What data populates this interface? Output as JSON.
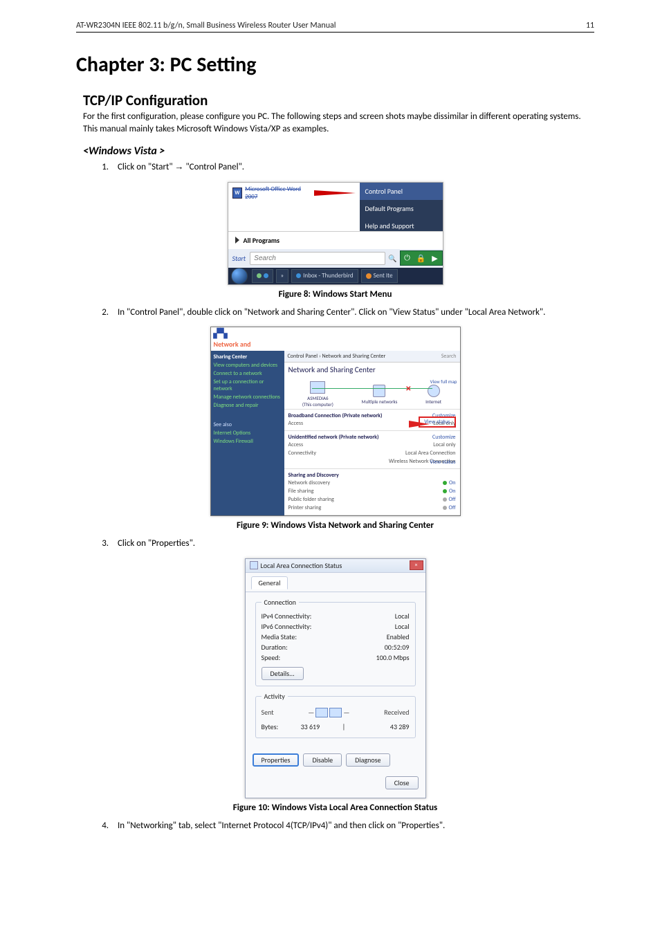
{
  "header": {
    "left": "AT-WR2304N IEEE 802.11 b/g/n, Small Business Wireless Router User Manual",
    "right": "11"
  },
  "h1": "Chapter 3: PC Setting",
  "h2": "TCP/IP Configuration",
  "intro": "For the first configuration, please configure you PC. The following steps and screen shots maybe dissimilar in different operating systems. This manual mainly takes Microsoft Windows Vista/XP as examples.",
  "h3": "<Windows Vista >",
  "steps": {
    "s1a": "Click on \"Start\" ",
    "s1b": " \"Control Panel\".",
    "s2": "In \"Control Panel\", double click on \"Network and Sharing Center\". Click on \"View Status\" under \"Local Area Network\".",
    "s3": "Click on \"Properties\".",
    "s4": "In \"Networking\" tab, select \"Internet Protocol 4(TCP/IPv4)\" and then click on \"Properties\"."
  },
  "arrow": "→",
  "fig": {
    "c8": "Figure 8: Windows Start Menu",
    "c9": "Figure 9: Windows Vista Network and Sharing Center",
    "c10": "Figure 10: Windows Vista Local Area Connection Status"
  },
  "fig8": {
    "word": "Microsoft Office Word 2007",
    "cp": "Control Panel",
    "dp": "Default Programs",
    "hs": "Help and Support",
    "allprog": "All Programs",
    "startlbl": "Start",
    "search": "Search",
    "tb_inbox": "Inbox - Thunderbird",
    "tb_sent": "Sent Ite"
  },
  "fig9": {
    "netand": "Network and",
    "sharing": "Sharing",
    "center": "Center",
    "crumb": "Control Panel  ›  Network and Sharing Center",
    "searchhint": "Search",
    "title": "Network and Sharing Center",
    "viewmap": "View full map",
    "node_pc": "(This computer)",
    "node_net": "Multiple networks",
    "node_int": "Internet",
    "sec1": "Broadband Connection (Private network)",
    "sec2": "Unidentified network (Private network)",
    "access": "Access",
    "localonly": "Local only",
    "connectivity": "Connectivity",
    "lac": "Local Area Connection",
    "wnc": "Wireless Network Connection",
    "customize": "Customize",
    "viewstatus": "View status",
    "sd_title": "Sharing and Discovery",
    "sd1": "Network discovery",
    "sd1v": "On",
    "sd2": "File sharing",
    "sd2v": "On",
    "sd3": "Public folder sharing",
    "sd3v": "Off",
    "sd4": "Printer sharing",
    "sd4v": "Off",
    "tasks_view": "View computers and devices",
    "tasks_conn": "Connect to a network",
    "tasks_setup": "Set up a connection or network",
    "tasks_manage": "Manage network connections",
    "tasks_diag": "Diagnose and repair",
    "seealso": "See also",
    "sa1": "Internet Options",
    "sa2": "Windows Firewall"
  },
  "fig10": {
    "title": "Local Area Connection Status",
    "tab": "General",
    "grp_conn": "Connection",
    "ipv4l": "IPv4 Connectivity:",
    "ipv4v": "Local",
    "ipv6l": "IPv6 Connectivity:",
    "ipv6v": "Local",
    "medial": "Media State:",
    "mediav": "Enabled",
    "durl": "Duration:",
    "durv": "00:52:09",
    "spdl": "Speed:",
    "spdv": "100.0 Mbps",
    "details": "Details...",
    "grp_act": "Activity",
    "sent": "Sent",
    "received": "Received",
    "bytesl": "Bytes:",
    "bytes_sent": "33 619",
    "bytes_recv": "43 289",
    "properties": "Properties",
    "disable": "Disable",
    "diagnose": "Diagnose",
    "close": "Close"
  }
}
